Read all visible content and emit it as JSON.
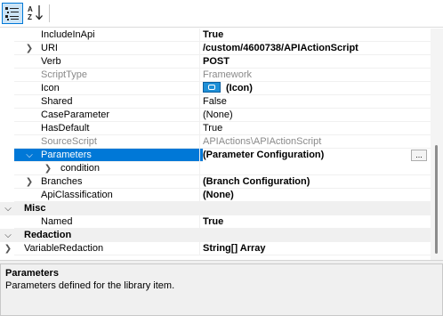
{
  "toolbar": {
    "categorized_icon": "categorized-view-icon",
    "alphabetical_icon": "sort-az-icon"
  },
  "properties": {
    "include_in_api": {
      "name": "IncludeInApi",
      "value": "True"
    },
    "uri": {
      "name": "URI",
      "value": "/custom/4600738/APIActionScript"
    },
    "verb": {
      "name": "Verb",
      "value": "POST"
    },
    "script_type": {
      "name": "ScriptType",
      "value": "Framework"
    },
    "icon": {
      "name": "Icon",
      "value": "(Icon)"
    },
    "shared": {
      "name": "Shared",
      "value": "False"
    },
    "case_parameter": {
      "name": "CaseParameter",
      "value": "(None)"
    },
    "has_default": {
      "name": "HasDefault",
      "value": "True"
    },
    "source_script": {
      "name": "SourceScript",
      "value": "APIActions\\APIActionScript"
    },
    "parameters": {
      "name": "Parameters",
      "value": "(Parameter Configuration)",
      "button": "..."
    },
    "condition": {
      "name": "condition"
    },
    "branches": {
      "name": "Branches",
      "value": "(Branch Configuration)"
    },
    "api_classification": {
      "name": "ApiClassification",
      "value": "(None)"
    }
  },
  "categories": {
    "misc": {
      "name": "Misc"
    },
    "redaction": {
      "name": "Redaction"
    }
  },
  "misc_props": {
    "named": {
      "name": "Named",
      "value": "True"
    }
  },
  "redaction_props": {
    "variable_redaction": {
      "name": "VariableRedaction",
      "value": "String[] Array"
    }
  },
  "help": {
    "title": "Parameters",
    "description": "Parameters defined for the library item."
  },
  "colors": {
    "selection": "#0078d7",
    "category_bg": "#f0f0f0",
    "readonly_text": "#8a8a8a"
  }
}
